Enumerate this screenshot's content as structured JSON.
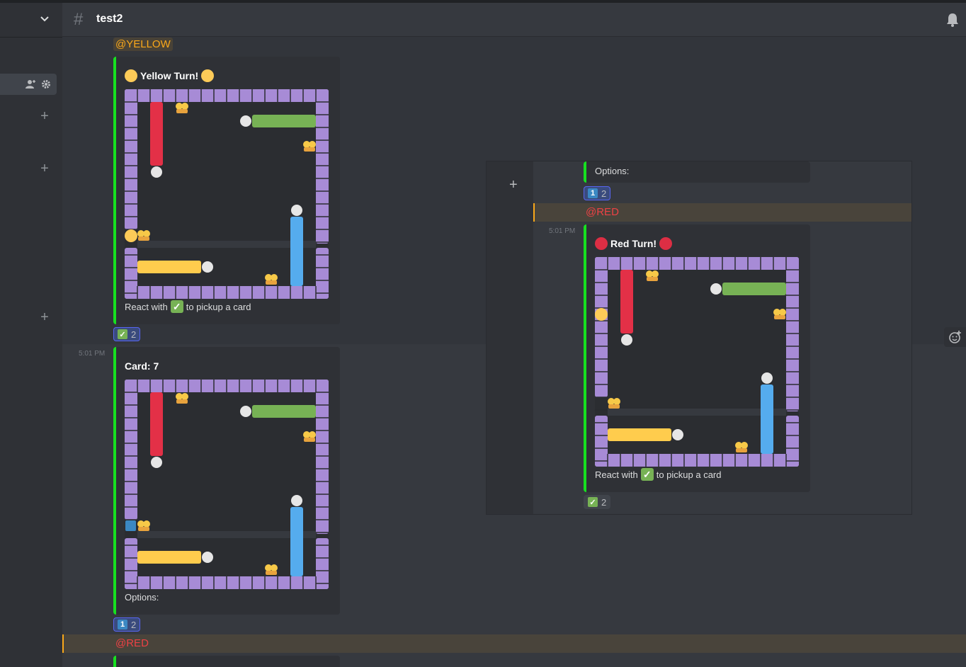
{
  "channel": {
    "name": "test2",
    "hash": "#"
  },
  "sidebar": {
    "plus": "+"
  },
  "colors": {
    "embed_accent": "#17e020",
    "board_border": "#a78bd6",
    "red": "#e33047",
    "green": "#77b255",
    "yellow": "#ffcc4d",
    "blue": "#55acee",
    "white": "#e6e6e6",
    "yellow_token": "#fdcb58",
    "red_token": "#dd2e44"
  },
  "messages": [
    {
      "mention": "@YELLOW",
      "title": "Yellow Turn!",
      "token": "yellow-circle",
      "footer_pre": "React with",
      "footer_post": "to pickup a card",
      "reaction_count": "2"
    },
    {
      "timestamp": "5:01 PM",
      "title": "Card: 7",
      "footer": "Options:",
      "reaction_key": "1",
      "reaction_count": "2"
    },
    {
      "mention": "@RED"
    }
  ],
  "popup": {
    "plus": "+",
    "options": "Options:",
    "reaction_key": "1",
    "reaction_count": "2",
    "mention": "@RED",
    "timestamp": "5:01 PM",
    "title": "Red Turn!",
    "footer_pre": "React with",
    "footer_post": "to pickup a card",
    "check_count": "2"
  },
  "icons": {
    "chevron": "chevron-down-icon",
    "bell": "bell-icon",
    "add_reaction": "add-reaction-icon",
    "add_member": "add-member-icon",
    "settings": "gear-icon"
  }
}
